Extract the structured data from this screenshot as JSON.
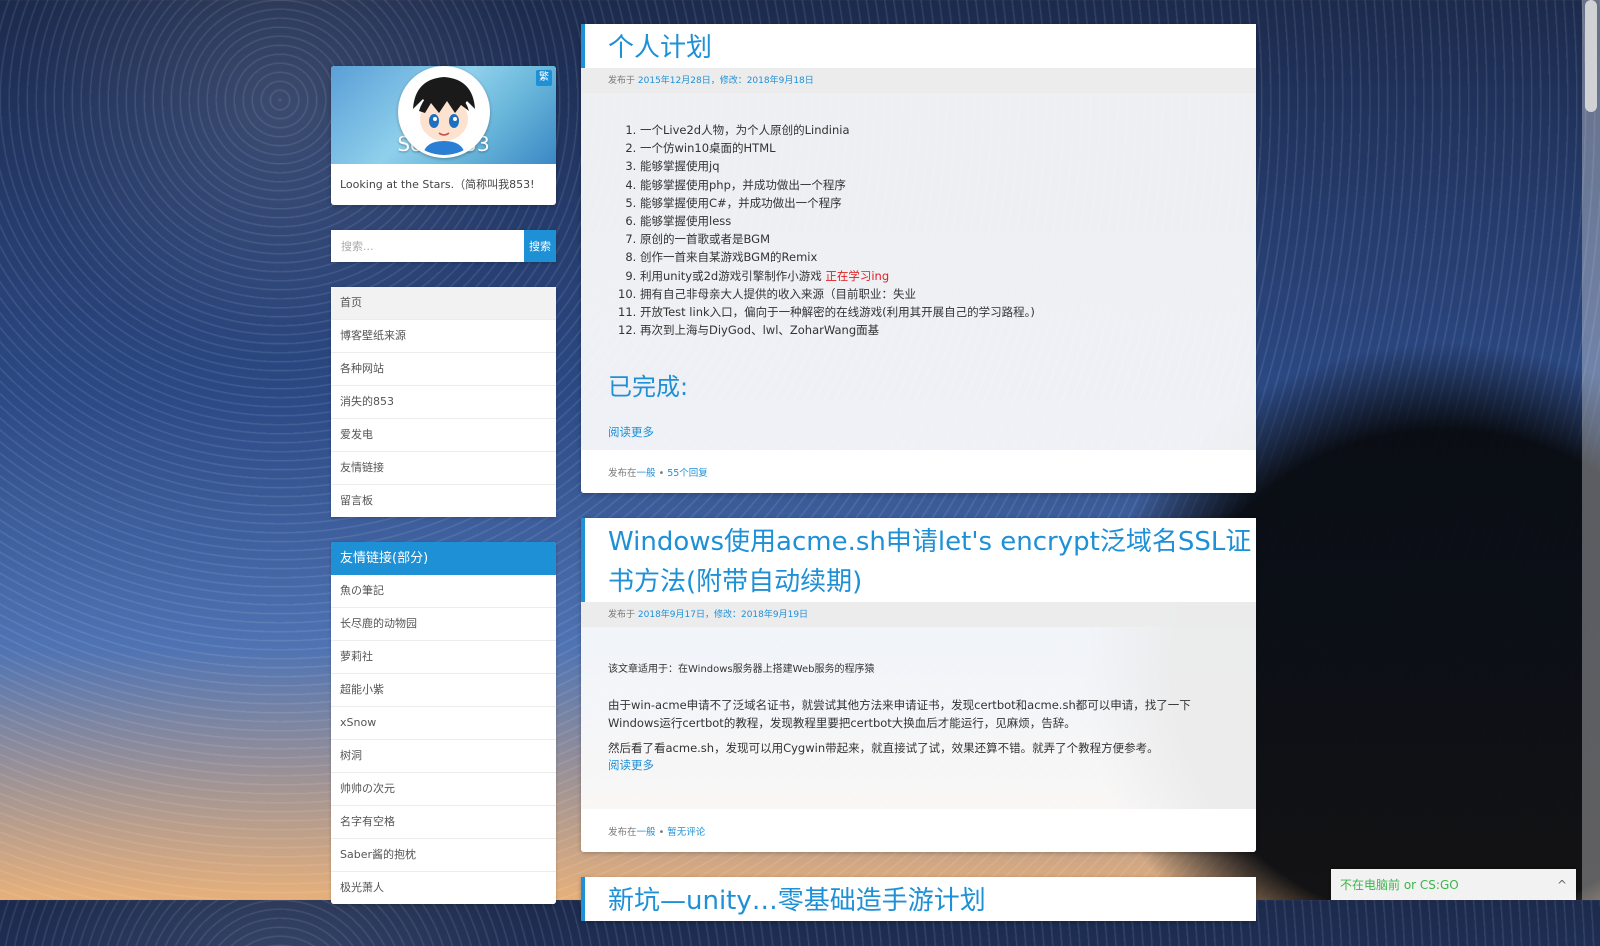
{
  "sidebar": {
    "site_name": "Sonic853",
    "trad_badge": "繁",
    "tagline": "Looking at the Stars.（简称叫我853!",
    "search": {
      "placeholder": "搜索...",
      "button": "搜索"
    },
    "nav_items": [
      "首页",
      "博客壁纸来源",
      "各种网站",
      "消失的853",
      "爱发电",
      "友情链接",
      "留言板"
    ],
    "links_title": "友情链接(部分)",
    "links": [
      "魚の筆記",
      "长尽鹿的动物园",
      "萝莉社",
      "超能小紫",
      "xSnow",
      "树洞",
      "帅帅の次元",
      "名字有空格",
      "Saber酱的抱枕",
      "极光萧人"
    ]
  },
  "posts": [
    {
      "title": "个人计划",
      "meta_prefix": "发布于",
      "meta_dates": "2015年12月28日，修改：2018年9月18日",
      "list": [
        "一个Live2d人物，为个人原创的Lindinia",
        "一个仿win10桌面的HTML",
        "能够掌握使用jq",
        "能够掌握使用php，并成功做出一个程序",
        "能够掌握使用C#，并成功做出一个程序",
        "能够掌握使用less",
        "原创的一首歌或者是BGM",
        "创作一首来自某游戏BGM的Remix",
        "利用unity或2d游戏引擎制作小游戏",
        "拥有自己非母亲大人提供的收入来源（目前职业：失业",
        "开放Test link入口，偏向于一种解密的在线游戏(利用其开展自己的学习路程。)",
        "再次到上海与DiyGod、lwl、ZoharWang面基"
      ],
      "item9_red": "正在学习ing",
      "completed_heading": "已完成:",
      "read_more": "阅读更多",
      "foot_prefix": "发布在",
      "foot_category": "一般",
      "foot_sep": "•",
      "foot_comments": "55个回复"
    },
    {
      "title": "Windows使用acme.sh申请let's encrypt泛域名SSL证书方法(附带自动续期)",
      "meta_prefix": "发布于",
      "meta_dates": "2018年9月17日，修改：2018年9月19日",
      "intro": "该文章适用于：在Windows服务器上搭建Web服务的程序猿",
      "para1": "由于win-acme申请不了泛域名证书，就尝试其他方法来申请证书，发现certbot和acme.sh都可以申请，找了一下Windows运行certbot的教程，发现教程里要把certbot大换血后才能运行，见麻烦，告辞。",
      "para2": "然后看了看acme.sh，发现可以用Cygwin带起来，就直接试了试，效果还算不错。就弄了个教程方便参考。",
      "read_more": "阅读更多",
      "foot_prefix": "发布在",
      "foot_category": "一般",
      "foot_sep": "•",
      "foot_comments": "暂无评论"
    },
    {
      "title": "新坑—unity…零基础造手游计划"
    }
  ],
  "music_bar": {
    "text": "不在电脑前 or CS:GO",
    "toggle": "^"
  },
  "colors": {
    "accent": "#1e90d6",
    "highlight_red": "#e02020",
    "music_green": "#3bb54a"
  }
}
